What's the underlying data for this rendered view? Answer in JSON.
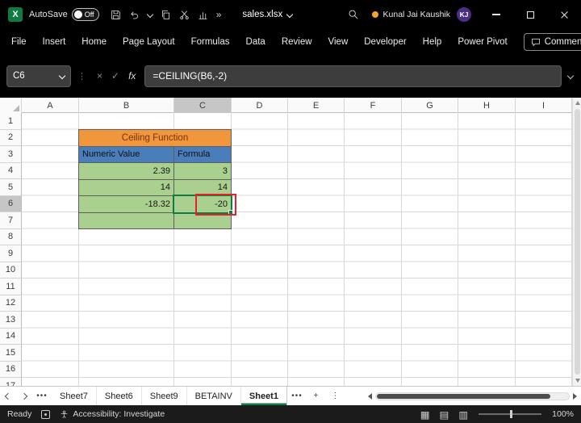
{
  "titlebar": {
    "logo_letter": "X",
    "autosave_label": "AutoSave",
    "autosave_state": "Off",
    "overflow_glyph": "»",
    "filename": "sales.xlsx",
    "user_name": "Kunal Jai Kaushik",
    "user_initials": "KJ"
  },
  "menubar": {
    "tabs": [
      "File",
      "Insert",
      "Home",
      "Page Layout",
      "Formulas",
      "Data",
      "Review",
      "View",
      "Developer",
      "Help",
      "Power Pivot"
    ],
    "comments_label": "Comments"
  },
  "formula_bar": {
    "name_box": "C6",
    "cancel_glyph": "×",
    "check_glyph": "✓",
    "fx_label": "fx",
    "formula": "=CEILING(B6,-2)"
  },
  "grid": {
    "columns": [
      "A",
      "B",
      "C",
      "D",
      "E",
      "F",
      "G",
      "H",
      "I"
    ],
    "rows": [
      "1",
      "2",
      "3",
      "4",
      "5",
      "6",
      "7",
      "8",
      "9",
      "10",
      "11",
      "12",
      "13",
      "14",
      "15",
      "16",
      "17"
    ],
    "selected_cell": "C6"
  },
  "table": {
    "title": "Ceiling Function",
    "headers": [
      "Numeric Value",
      "Formula"
    ],
    "rows": [
      {
        "value": "2.39",
        "result": "3"
      },
      {
        "value": "14",
        "result": "14"
      },
      {
        "value": "-18.32",
        "result": "-20"
      }
    ]
  },
  "sheet_tabs": {
    "items": [
      "Sheet7",
      "Sheet6",
      "Sheet9",
      "BETAINV",
      "Sheet1"
    ],
    "active": "Sheet1",
    "more_glyph": "•••",
    "add_glyph": "+",
    "menu_glyph": "⋮"
  },
  "status_bar": {
    "mode": "Ready",
    "accessibility_label": "Accessibility: Investigate",
    "zoom_level": "100%"
  },
  "colors": {
    "table_title_bg": "#F0963C",
    "table_title_text": "#7F3000",
    "table_header_bg": "#4A7EBB",
    "table_cell_bg": "#A9D08E",
    "selection_green": "#107C41",
    "annotation_red": "#E8202C",
    "accent_green": "#1E9E5A",
    "avatar_bg": "#4B2F86",
    "presence_orange": "#F5A623"
  }
}
